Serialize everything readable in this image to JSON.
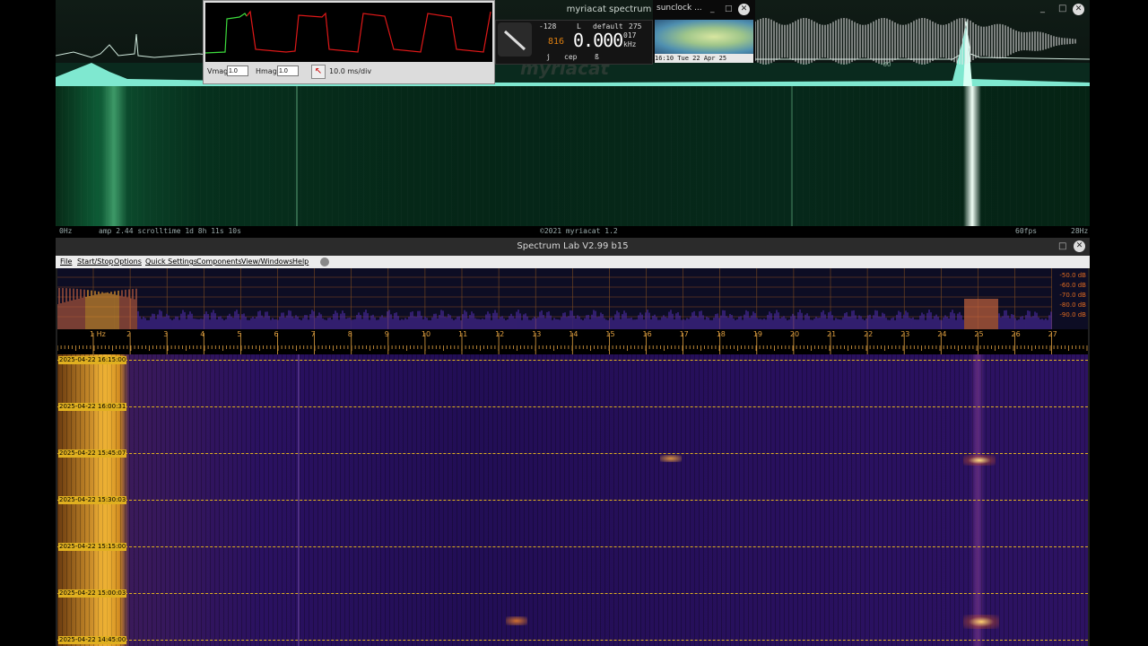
{
  "myriacat": {
    "title": "myriacat spectrum analyzer",
    "watermark": "myriacat",
    "status": {
      "left_hz": "0Hz",
      "info": "amp 2.44   scrolltime 1d 8h 11s 10s",
      "copyright": "©2021 myriacat 1.2",
      "fps": "60fps",
      "right_hz": "28Hz"
    },
    "waveform_label": "-60"
  },
  "scope": {
    "vmag_label": "Vmag",
    "vmag_value": "1.0",
    "hmag_label": "Hmag",
    "hmag_value": "1.0",
    "timebase": "10.0 ms/div",
    "colors": {
      "ch1": "#3ddc3d",
      "ch2": "#e01818"
    }
  },
  "meter": {
    "level": "-128",
    "mode": "L",
    "preset": "default",
    "number": "275",
    "freq": "0.000",
    "freq_small": "017",
    "unit": "kHz",
    "orange": "816",
    "btn1": "j",
    "btn2": "cep",
    "btn3": "ß"
  },
  "sunclock": {
    "title": "sunclock ...",
    "time": "16:10  Tue 22 Apr 25"
  },
  "spectrumlab": {
    "title": "Spectrum Lab V2.99 b15",
    "menu": [
      "File",
      "Start/Stop",
      "Options",
      "Quick Settings",
      "Components",
      "View/Windows",
      "Help"
    ],
    "db_labels": [
      "-50.0 dB",
      "-60.0 dB",
      "-70.0 dB",
      "-80.0 dB",
      "-90.0 dB"
    ],
    "hz_labels": [
      "1 Hz",
      "2",
      "3",
      "4",
      "5",
      "6",
      "7",
      "8",
      "9",
      "10",
      "11",
      "12",
      "13",
      "14",
      "15",
      "16",
      "17",
      "18",
      "19",
      "20",
      "21",
      "22",
      "23",
      "24",
      "25",
      "26",
      "27"
    ],
    "timestamps": [
      "2025-04-22 16:15:00",
      "2025-04-22 16:00:31",
      "2025-04-22 15:45:07",
      "2025-04-22 15:30:03",
      "2025-04-22 15:15:00",
      "2025-04-22 15:00:03",
      "2025-04-22 14:45:00"
    ],
    "colors": {
      "accent": "#e0a040",
      "waterfall": "#2a1160"
    }
  }
}
